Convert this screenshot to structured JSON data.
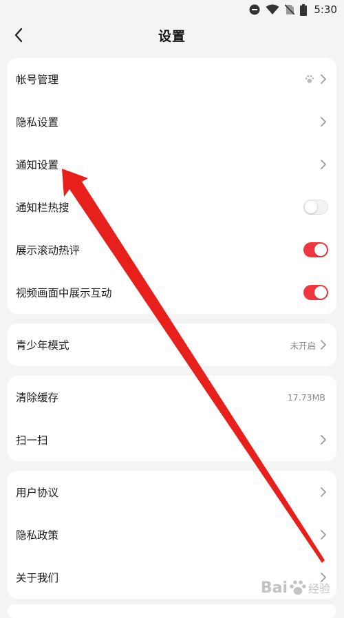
{
  "status_bar": {
    "time": "5:30",
    "icons": [
      "do-not-disturb-icon",
      "wifi-icon",
      "no-sim-icon",
      "battery-icon"
    ]
  },
  "header": {
    "title": "设置",
    "back_icon": "chevron-left-icon"
  },
  "groups": [
    {
      "items": [
        {
          "label": "帐号管理",
          "trailing": "chevron",
          "extra_icon": "paw-icon"
        },
        {
          "label": "隐私设置",
          "trailing": "chevron"
        },
        {
          "label": "通知设置",
          "trailing": "chevron"
        },
        {
          "label": "通知栏热搜",
          "trailing": "toggle",
          "on": false
        },
        {
          "label": "展示滚动热评",
          "trailing": "toggle",
          "on": true
        },
        {
          "label": "视频画面中展示互动",
          "trailing": "toggle",
          "on": true
        }
      ]
    },
    {
      "items": [
        {
          "label": "青少年模式",
          "value": "未开启",
          "trailing": "chevron"
        }
      ]
    },
    {
      "items": [
        {
          "label": "清除缓存",
          "value": "17.73MB"
        },
        {
          "label": "扫一扫",
          "trailing": "chevron"
        }
      ]
    },
    {
      "items": [
        {
          "label": "用户协议",
          "trailing": "chevron"
        },
        {
          "label": "隐私政策",
          "trailing": "chevron"
        },
        {
          "label": "关于我们",
          "trailing": "chevron"
        }
      ]
    }
  ],
  "colors": {
    "accent_toggle_on": "#f0373e",
    "annotation_arrow": "#e8201c",
    "background": "#f4f4f4",
    "card": "#ffffff"
  },
  "watermark": {
    "text": "Bai",
    "sub": "经验"
  }
}
